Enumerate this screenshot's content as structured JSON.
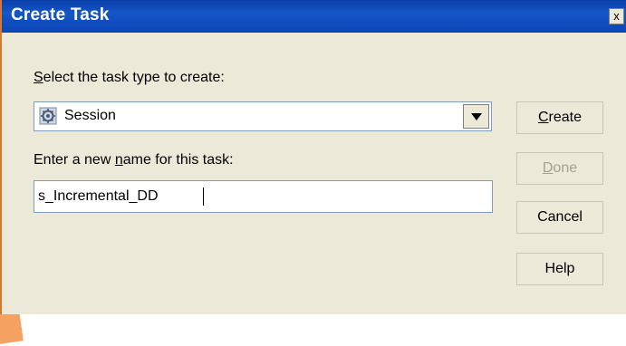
{
  "window": {
    "title": "Create Task",
    "close_label": "x"
  },
  "form": {
    "task_type_label_acc": "S",
    "task_type_label_rest": "elect the task type to create:",
    "task_type_value": "Session",
    "name_label_pre": "Enter a new ",
    "name_label_acc": "n",
    "name_label_post": "ame for this task:",
    "name_value": "s_Incremental_DD"
  },
  "buttons": {
    "create_acc": "C",
    "create_rest": "reate",
    "done_acc": "D",
    "done_rest": "one",
    "cancel": "Cancel",
    "help": "Help"
  },
  "icons": {
    "task_type_icon": "session-gear-icon",
    "dropdown_icon": "chevron-down-icon"
  }
}
